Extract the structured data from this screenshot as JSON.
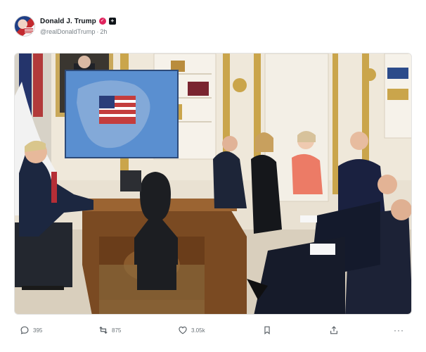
{
  "post": {
    "author": {
      "display_name": "Donald J. Trump",
      "handle": "@realDonaldTrump",
      "separator": "·",
      "time_ago": "2h",
      "avatar_icon": "profile-photo",
      "verified_icon": "verified-badge-icon",
      "affiliation_icon": "platform-badge-icon"
    },
    "media": {
      "type": "photo",
      "subject_icons": [
        "map-screen",
        "bust-sculpture",
        "resolute-desk"
      ]
    },
    "actions": {
      "replies": {
        "icon": "reply-icon",
        "count": "395"
      },
      "reposts": {
        "icon": "repost-icon",
        "count": "875"
      },
      "likes": {
        "icon": "heart-icon",
        "count": "3.05k"
      },
      "bookmark": {
        "icon": "bookmark-icon"
      },
      "share": {
        "icon": "share-icon"
      },
      "more": {
        "icon": "more-icon",
        "label": "···"
      }
    }
  }
}
